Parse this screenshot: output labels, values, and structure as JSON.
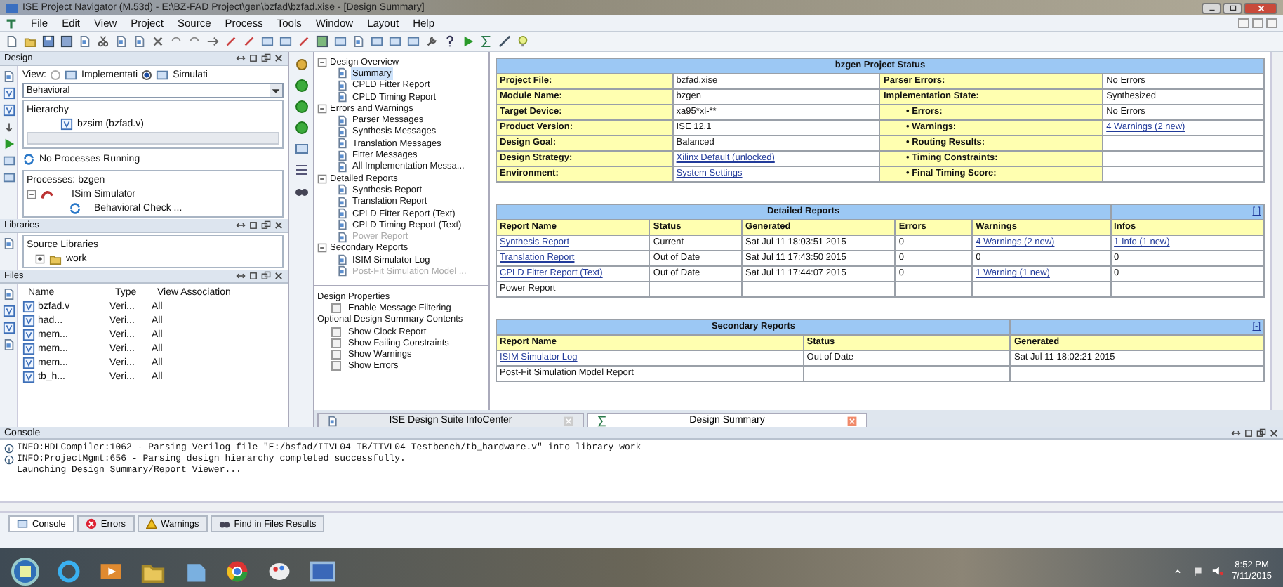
{
  "window": {
    "title": "ISE Project Navigator (M.53d) - E:\\BZ-FAD Project\\gen\\bzfad\\bzfad.xise - [Design Summary]"
  },
  "menu": [
    "File",
    "Edit",
    "View",
    "Project",
    "Source",
    "Process",
    "Tools",
    "Window",
    "Layout",
    "Help"
  ],
  "design_panel": {
    "title": "Design",
    "view_label": "View:",
    "view_options": [
      {
        "label": "Implementati",
        "selected": false
      },
      {
        "label": "Simulati",
        "selected": true
      }
    ],
    "dropdown": "Behavioral",
    "hierarchy_title": "Hierarchy",
    "hierarchy_items": [
      "bzsim (bzfad.v)"
    ],
    "status": "No Processes Running",
    "processes_title": "Processes: bzgen",
    "processes": [
      {
        "label": "ISim Simulator",
        "expanded": true,
        "children": [
          {
            "label": "Behavioral Check ..."
          }
        ]
      }
    ]
  },
  "libraries_panel": {
    "title": "Libraries",
    "header": "Source Libraries",
    "items": [
      {
        "label": "work",
        "expanded": false
      }
    ]
  },
  "files_panel": {
    "title": "Files",
    "columns": [
      "Name",
      "Type",
      "View Association"
    ],
    "rows": [
      [
        "bzfad.v",
        "Veri...",
        "All"
      ],
      [
        "had...",
        "Veri...",
        "All"
      ],
      [
        "mem...",
        "Veri...",
        "All"
      ],
      [
        "mem...",
        "Veri...",
        "All"
      ],
      [
        "mem...",
        "Veri...",
        "All"
      ],
      [
        "tb_h...",
        "Veri...",
        "All"
      ]
    ]
  },
  "summary_tree": [
    {
      "label": "Design Overview",
      "expanded": true,
      "children": [
        {
          "label": "Summary",
          "selected": true,
          "disabled": false
        },
        {
          "label": "CPLD Fitter Report",
          "selected": false,
          "disabled": false
        },
        {
          "label": "CPLD Timing Report",
          "selected": false,
          "disabled": false
        }
      ]
    },
    {
      "label": "Errors and Warnings",
      "expanded": true,
      "children": [
        {
          "label": "Parser Messages",
          "selected": false,
          "disabled": false
        },
        {
          "label": "Synthesis Messages",
          "selected": false,
          "disabled": false
        },
        {
          "label": "Translation Messages",
          "selected": false,
          "disabled": false
        },
        {
          "label": "Fitter Messages",
          "selected": false,
          "disabled": false
        },
        {
          "label": "All Implementation Messa...",
          "selected": false,
          "disabled": false
        }
      ]
    },
    {
      "label": "Detailed Reports",
      "expanded": true,
      "children": [
        {
          "label": "Synthesis Report",
          "selected": false,
          "disabled": false
        },
        {
          "label": "Translation Report",
          "selected": false,
          "disabled": false
        },
        {
          "label": "CPLD Fitter Report (Text)",
          "selected": false,
          "disabled": false
        },
        {
          "label": "CPLD Timing Report (Text)",
          "selected": false,
          "disabled": false
        },
        {
          "label": "Power Report",
          "selected": false,
          "disabled": true
        }
      ]
    },
    {
      "label": "Secondary Reports",
      "expanded": true,
      "children": [
        {
          "label": "ISIM Simulator Log",
          "selected": false,
          "disabled": false
        },
        {
          "label": "Post-Fit Simulation Model ...",
          "selected": false,
          "disabled": true
        }
      ]
    }
  ],
  "properties": [
    {
      "title": "Design Properties",
      "options": [
        {
          "label": "Enable Message Filtering",
          "checked": false
        }
      ]
    },
    {
      "title": "Optional Design Summary Contents",
      "options": [
        {
          "label": "Show Clock Report",
          "checked": false
        },
        {
          "label": "Show Failing Constraints",
          "checked": false
        },
        {
          "label": "Show Warnings",
          "checked": false
        },
        {
          "label": "Show Errors",
          "checked": false
        }
      ]
    }
  ],
  "document_tabs": [
    {
      "label": "ISE Design Suite InfoCenter",
      "selected": false
    },
    {
      "label": "Design Summary",
      "selected": true
    }
  ],
  "project_status": {
    "title": "bzgen Project Status",
    "rows": [
      {
        "label": "Project File:",
        "value": {
          "text": "bzfad.xise",
          "link": false
        },
        "label2": "Parser Errors:",
        "sub": false,
        "value2": {
          "text": "No Errors",
          "link": false
        }
      },
      {
        "label": "Module Name:",
        "value": {
          "text": "bzgen",
          "link": false
        },
        "label2": "Implementation State:",
        "sub": false,
        "value2": {
          "text": "Synthesized",
          "link": false
        }
      },
      {
        "label": "Target Device:",
        "value": {
          "text": "xa95*xl-**",
          "link": false
        },
        "label2": "• Errors:",
        "sub": true,
        "value2": {
          "text": "No Errors",
          "link": false
        }
      },
      {
        "label": "Product Version:",
        "value": {
          "text": "ISE 12.1",
          "link": false
        },
        "label2": "• Warnings:",
        "sub": true,
        "value2": {
          "text": "4 Warnings (2 new)",
          "link": true
        }
      },
      {
        "label": "Design Goal:",
        "value": {
          "text": "Balanced",
          "link": false
        },
        "label2": "• Routing Results:",
        "sub": true,
        "value2": {}
      },
      {
        "label": "Design Strategy:",
        "value": {
          "text": "Xilinx Default (unlocked)",
          "link": true
        },
        "label2": "• Timing Constraints:",
        "sub": true,
        "value2": {}
      },
      {
        "label": "Environment:",
        "value": {
          "text": "System Settings",
          "link": true
        },
        "label2": "• Final Timing Score:",
        "sub": true,
        "value2": {}
      }
    ]
  },
  "detailed_reports": {
    "title": "Detailed Reports",
    "toggle": "[-]",
    "columns": [
      "Report Name",
      "Status",
      "Generated",
      "Errors",
      "Warnings",
      "Infos"
    ],
    "rows": [
      [
        {
          "text": "Synthesis Report",
          "link": true
        },
        {
          "text": "Current",
          "link": false
        },
        {
          "text": "Sat Jul 11 18:03:51 2015",
          "link": false
        },
        {
          "text": "0",
          "link": false
        },
        {
          "text": "4 Warnings (2 new)",
          "link": true
        },
        {
          "text": "1 Info (1 new)",
          "link": true
        }
      ],
      [
        {
          "text": "Translation Report",
          "link": true
        },
        {
          "text": "Out of Date",
          "link": false
        },
        {
          "text": "Sat Jul 11 17:43:50 2015",
          "link": false
        },
        {
          "text": "0",
          "link": false
        },
        {
          "text": "0",
          "link": false
        },
        {
          "text": "0",
          "link": false
        }
      ],
      [
        {
          "text": "CPLD Fitter Report (Text)",
          "link": true
        },
        {
          "text": "Out of Date",
          "link": false
        },
        {
          "text": "Sat Jul 11 17:44:07 2015",
          "link": false
        },
        {
          "text": "0",
          "link": false
        },
        {
          "text": "1 Warning (1 new)",
          "link": true
        },
        {
          "text": "0",
          "link": false
        }
      ],
      [
        {
          "text": "Power Report",
          "link": false
        },
        {},
        {},
        {},
        {},
        {}
      ]
    ]
  },
  "secondary_reports": {
    "title": "Secondary Reports",
    "toggle": "[-]",
    "columns": [
      "Report Name",
      "Status",
      "Generated"
    ],
    "rows": [
      [
        {
          "text": "ISIM Simulator Log",
          "link": true
        },
        {
          "text": "Out of Date",
          "link": false
        },
        {
          "text": "Sat Jul 11 18:02:21 2015",
          "link": false
        }
      ],
      [
        {
          "text": "Post-Fit Simulation Model Report",
          "link": false
        },
        {},
        {}
      ]
    ]
  },
  "console": {
    "title": "Console",
    "lines": [
      {
        "kind": "info",
        "text": "INFO:HDLCompiler:1062 - Parsing Verilog file \"E:/bsfad/ITVL04 TB/ITVL04 Testbench/tb_hardware.v\" into library work"
      },
      {
        "kind": "info",
        "text": "INFO:ProjectMgmt:656 - Parsing design hierarchy completed successfully."
      },
      {
        "kind": "plain",
        "text": "Launching Design Summary/Report Viewer..."
      }
    ]
  },
  "console_tabs": [
    {
      "kind": "console",
      "label": "Console",
      "selected": true
    },
    {
      "kind": "errors",
      "label": "Errors",
      "selected": false
    },
    {
      "kind": "warnings",
      "label": "Warnings",
      "selected": false
    },
    {
      "kind": "find",
      "label": "Find in Files Results",
      "selected": false
    }
  ],
  "taskbar": {
    "time": "8:52 PM",
    "date": "7/11/2015"
  }
}
